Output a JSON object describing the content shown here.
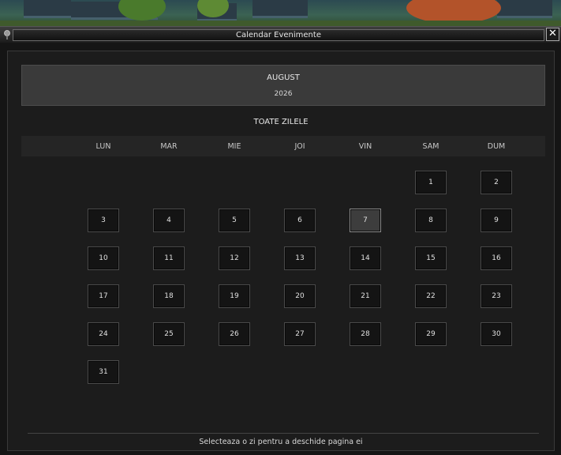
{
  "window": {
    "title": "Calendar Evenimente",
    "close_label": "✕"
  },
  "calendar": {
    "month": "AUGUST",
    "year": "2026",
    "filter": "TOATE ZILELE",
    "weekdays": [
      "LUN",
      "MAR",
      "MIE",
      "JOI",
      "VIN",
      "SAM",
      "DUM"
    ],
    "first_weekday_index": 5,
    "days_in_month": 31,
    "selected_day": 7
  },
  "footer": {
    "hint": "Selecteaza o zi pentru a deschide pagina ei"
  }
}
